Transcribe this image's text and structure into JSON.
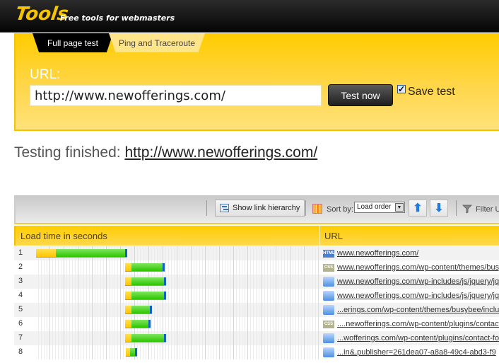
{
  "header": {
    "logo": "Tools",
    "tagline": "Free tools for webmasters"
  },
  "tabs": [
    {
      "label": "Full page test",
      "active": true
    },
    {
      "label": "Ping and Traceroute",
      "active": false
    }
  ],
  "form": {
    "url_label": "URL:",
    "url_value": "http://www.newofferings.com/",
    "test_button": "Test now",
    "save_test_label": "Save test",
    "save_test_checked": true
  },
  "status": {
    "prefix": "Testing finished:",
    "url": "http://www.newofferings.com/"
  },
  "toolbar": {
    "show_hierarchy": "Show link hierarchy",
    "sort_by_label": "Sort by:",
    "sort_value": "Load order",
    "filter_label": "Filter U"
  },
  "table": {
    "col_load": "Load time in seconds",
    "col_url": "URL",
    "rows": [
      {
        "num": "1",
        "type": "html",
        "url": "www.newofferings.com/",
        "start": 0.0,
        "wait": 0.14,
        "recv": 0.49
      },
      {
        "num": "2",
        "type": "css",
        "url": "www.newofferings.com/wp-content/themes/busybee",
        "start": 0.63,
        "wait": 0.045,
        "recv": 0.22
      },
      {
        "num": "3",
        "type": "js",
        "url": "www.newofferings.com/wp-includes/js/jquery/jquery",
        "start": 0.63,
        "wait": 0.045,
        "recv": 0.23
      },
      {
        "num": "4",
        "type": "js",
        "url": "www.newofferings.com/wp-includes/js/jquery/jquery",
        "start": 0.63,
        "wait": 0.045,
        "recv": 0.23
      },
      {
        "num": "5",
        "type": "js",
        "url": "...erings.com/wp-content/themes/busybee/includes",
        "start": 0.63,
        "wait": 0.045,
        "recv": 0.13
      },
      {
        "num": "6",
        "type": "css",
        "url": "....newofferings.com/wp-content/plugins/contact",
        "start": 0.63,
        "wait": 0.045,
        "recv": 0.12
      },
      {
        "num": "7",
        "type": "js",
        "url": "...wofferings.com/wp-content/plugins/contact-form",
        "start": 0.63,
        "wait": 0.045,
        "recv": 0.23
      },
      {
        "num": "8",
        "type": "js",
        "url": "...in&,publisher=261dea07-a8a8-49c4-abd3-f9",
        "start": 0.635,
        "wait": 0.03,
        "recv": 0.035
      }
    ]
  },
  "colors": {
    "accent_yellow": "#ffcc00",
    "wait": "#ffc400",
    "receive": "#2ec600",
    "end": "#1560c8"
  }
}
